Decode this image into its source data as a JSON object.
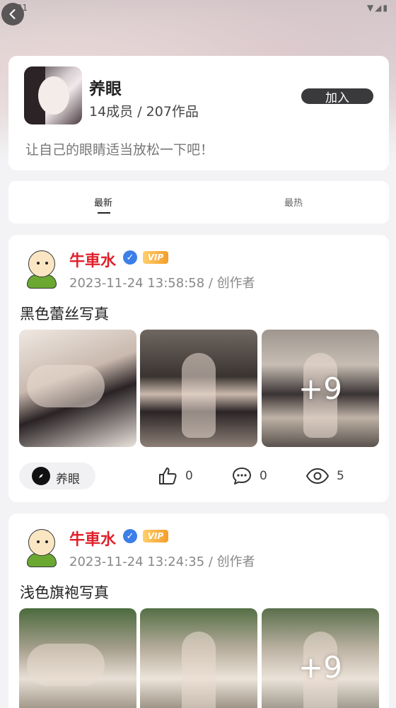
{
  "status_bar": {
    "time": "9:31",
    "icons": "▼◢▮"
  },
  "group": {
    "name": "养眼",
    "stats": "14成员 / 207作品",
    "join_label": "加入",
    "description": "让自己的眼睛适当放松一下吧！"
  },
  "tabs": [
    {
      "label": "最新",
      "active": true
    },
    {
      "label": "最热",
      "active": false
    }
  ],
  "posts": [
    {
      "author": "牛車水",
      "vip_label": "VIP",
      "meta": "2023-11-24 13:58:58 / 创作者",
      "title": "黑色蕾丝写真",
      "more_count": "+9",
      "tag": "养眼",
      "likes": "0",
      "comments": "0",
      "views": "5"
    },
    {
      "author": "牛車水",
      "vip_label": "VIP",
      "meta": "2023-11-24 13:24:35 / 创作者",
      "title": "浅色旗袍写真",
      "more_count": "+9"
    }
  ],
  "colors": {
    "author_name": "#e0202a",
    "verified": "#3d7fe8",
    "vip": "#f39d2a",
    "join_button": "#3a3a3c"
  }
}
